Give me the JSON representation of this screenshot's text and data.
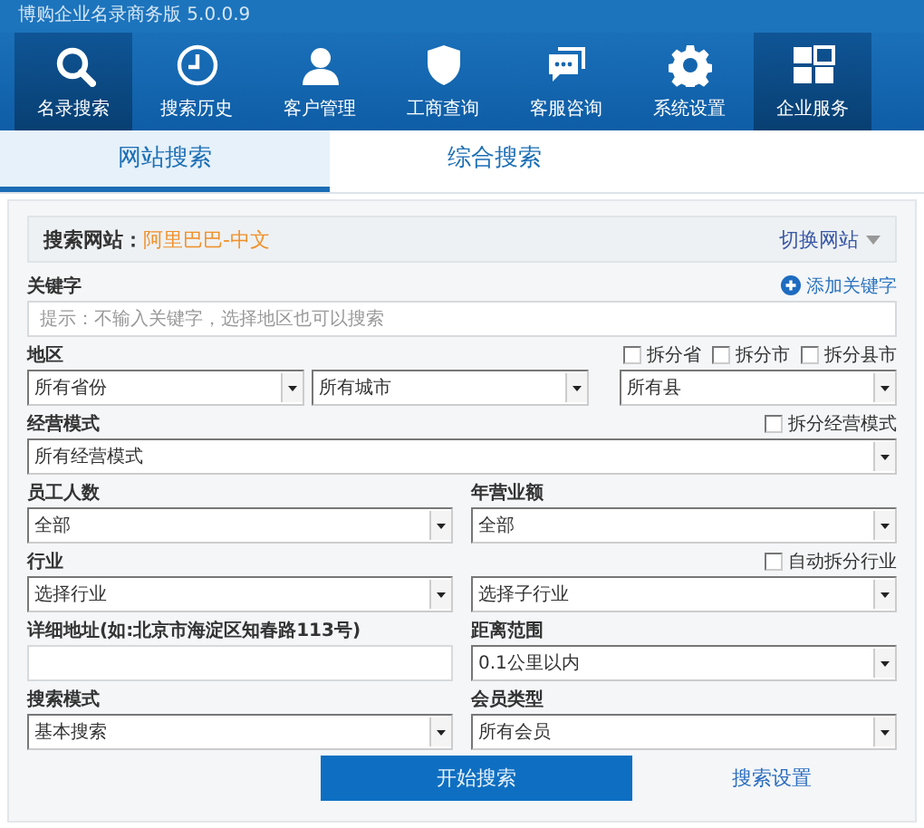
{
  "window": {
    "title": "博购企业名录商务版 5.0.0.9"
  },
  "nav": [
    {
      "label": "名录搜索",
      "kind": "search",
      "selected": true
    },
    {
      "label": "搜索历史",
      "kind": "history",
      "selected": false
    },
    {
      "label": "客户管理",
      "kind": "customers",
      "selected": false
    },
    {
      "label": "工商查询",
      "kind": "registry",
      "selected": false
    },
    {
      "label": "客服咨询",
      "kind": "support",
      "selected": false
    },
    {
      "label": "系统设置",
      "kind": "settings",
      "selected": false
    },
    {
      "label": "企业服务",
      "kind": "services",
      "selected": true
    }
  ],
  "tabs": [
    {
      "label": "网站搜索",
      "selected": true
    },
    {
      "label": "综合搜索",
      "selected": false
    }
  ],
  "form": {
    "site": {
      "label": "搜索网站：",
      "value": "阿里巴巴-中文",
      "action": "切换网站"
    },
    "rows": [
      {
        "label": "关键字",
        "action": "添加关键字",
        "controls": [
          {
            "kind": "input",
            "placeholder": "提示：不输入关键字，选择地区也可以搜索"
          }
        ]
      },
      {
        "label": "地区",
        "checkboxes": [
          {
            "label": "拆分省",
            "checked": false
          },
          {
            "label": "拆分市",
            "checked": false
          },
          {
            "label": "拆分县市",
            "checked": false
          }
        ],
        "controls": [
          {
            "kind": "select",
            "value": "所有省份"
          },
          {
            "kind": "select",
            "value": "所有城市"
          },
          {
            "kind": "select",
            "value": "所有县"
          }
        ]
      },
      {
        "label": "经营模式",
        "checkboxes": [
          {
            "label": "拆分经营模式",
            "checked": false
          }
        ],
        "controls": [
          {
            "kind": "select",
            "value": "所有经营模式"
          }
        ]
      },
      {
        "columns": [
          {
            "label": "员工人数",
            "control": {
              "kind": "select",
              "value": "全部"
            }
          },
          {
            "label": "年营业额",
            "control": {
              "kind": "select",
              "value": "全部"
            }
          }
        ]
      },
      {
        "label": "行业",
        "checkboxes": [
          {
            "label": "自动拆分行业",
            "checked": false
          }
        ],
        "controls": [
          {
            "kind": "select",
            "value": "选择行业"
          },
          {
            "kind": "select",
            "value": "选择子行业"
          }
        ]
      },
      {
        "columns": [
          {
            "label": "详细地址(如:北京市海淀区知春路113号)",
            "control": {
              "kind": "input"
            }
          },
          {
            "label": "距离范围",
            "control": {
              "kind": "select",
              "value": "0.1公里以内"
            }
          }
        ]
      },
      {
        "columns": [
          {
            "label": "搜索模式",
            "control": {
              "kind": "select",
              "value": "基本搜索"
            }
          },
          {
            "label": "会员类型",
            "control": {
              "kind": "select",
              "value": "所有会员"
            }
          }
        ]
      }
    ],
    "submit": "开始搜索",
    "settings": "搜索设置"
  }
}
